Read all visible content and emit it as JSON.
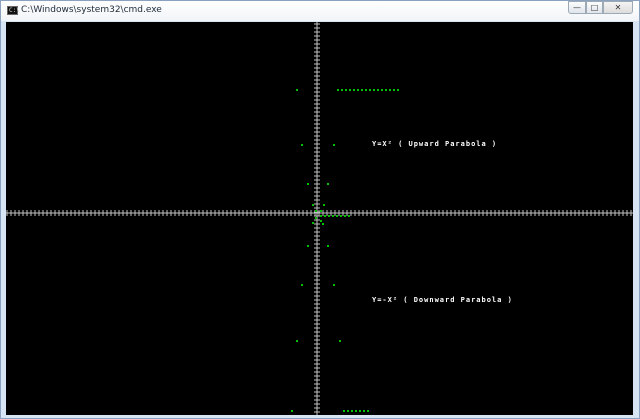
{
  "window": {
    "title": "C:\\Windows\\system32\\cmd.exe",
    "icon_text": "C:\\",
    "buttons": {
      "minimize": "—",
      "maximize": "□",
      "close": "✕"
    }
  },
  "console": {
    "background": "#000000",
    "axis_color": "#c0c0c0",
    "point_color": "#00c000",
    "upward_label": "Y=X² ( Upward Parabola )",
    "downward_label": "Y=-X² ( Downward Parabola )"
  }
}
